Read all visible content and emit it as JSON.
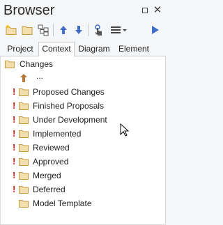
{
  "window": {
    "title": "Browser",
    "restore_icon": "restore-icon",
    "close_glyph": "✕"
  },
  "toolbar": {
    "icons": [
      "new-package-icon",
      "open-folder-icon",
      "hierarchy-icon",
      "move-up-icon",
      "move-down-icon",
      "touch-icon",
      "menu-icon",
      "run-icon"
    ]
  },
  "tabs": [
    {
      "label": "Project",
      "active": false
    },
    {
      "label": "Context",
      "active": true
    },
    {
      "label": "Diagram",
      "active": false
    },
    {
      "label": "Element",
      "active": false
    }
  ],
  "tree": {
    "root": "Changes",
    "parent_link": "...",
    "items": [
      {
        "label": "Proposed Changes",
        "flag": "!"
      },
      {
        "label": "Finished Proposals",
        "flag": "!"
      },
      {
        "label": "Under Development",
        "flag": "!"
      },
      {
        "label": "Implemented",
        "flag": "!"
      },
      {
        "label": "Reviewed",
        "flag": "!"
      },
      {
        "label": "Approved",
        "flag": "!"
      },
      {
        "label": "Merged",
        "flag": "!"
      },
      {
        "label": "Deferred",
        "flag": "!"
      },
      {
        "label": "Model Template",
        "flag": ""
      }
    ]
  },
  "colors": {
    "flag": "#d31414",
    "folder_fill": "#f3dfae",
    "folder_stroke": "#c49a43",
    "accent_blue": "#3f6fc9"
  }
}
